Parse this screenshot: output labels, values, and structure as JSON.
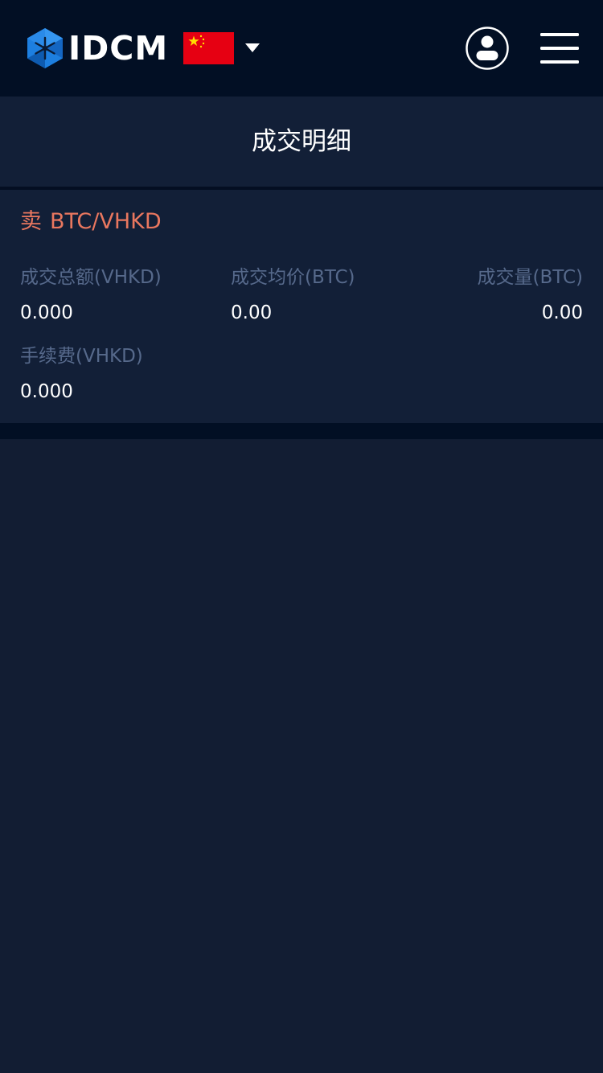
{
  "header": {
    "logo_text": "IDCM",
    "language_flag": "china-flag-icon",
    "icons": {
      "user": "user-icon",
      "menu": "hamburger-menu-icon",
      "caret": "caret-down-icon"
    }
  },
  "page": {
    "title": "成交明细"
  },
  "trade": {
    "side": "卖",
    "pair": "BTC/VHKD",
    "fields": [
      {
        "label": "成交总额(VHKD)",
        "value": "0.000"
      },
      {
        "label": "成交均价(BTC)",
        "value": "0.00"
      },
      {
        "label": "成交量(BTC)",
        "value": "0.00"
      },
      {
        "label": "手续费(VHKD)",
        "value": "0.000"
      }
    ]
  },
  "colors": {
    "topbar_bg": "#020f24",
    "panel_bg": "#121f37",
    "page_bg": "#121d33",
    "sell_accent": "#e9775f",
    "label_text": "#56698b",
    "value_text": "#ffffff"
  }
}
